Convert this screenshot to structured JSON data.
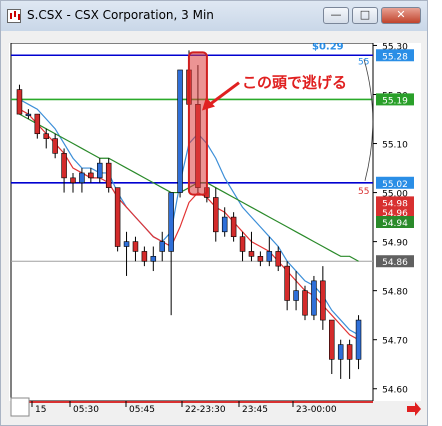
{
  "window": {
    "title": "S.CSX - CSX Corporation, 3 Min",
    "minimize_label": "—",
    "maximize_label": "□",
    "close_label": "✕",
    "app_icon": "chart-icon"
  },
  "chart_data": {
    "type": "candlestick",
    "ylim": [
      54.575,
      55.305
    ],
    "price_ticks": [
      "55.30",
      "55.20",
      "55.10",
      "55.00",
      "54.90",
      "54.80",
      "54.70",
      "54.60"
    ],
    "time_labels": [
      "15",
      "05:30",
      "05:45",
      "22-23:30",
      "23:45",
      "23-00:00"
    ],
    "candles": [
      {
        "o": 55.21,
        "h": 55.22,
        "l": 55.16,
        "c": 55.16
      },
      {
        "o": 55.16,
        "h": 55.17,
        "l": 55.15,
        "c": 55.16
      },
      {
        "o": 55.16,
        "h": 55.16,
        "l": 55.11,
        "c": 55.12
      },
      {
        "o": 55.12,
        "h": 55.13,
        "l": 55.09,
        "c": 55.11
      },
      {
        "o": 55.11,
        "h": 55.12,
        "l": 55.07,
        "c": 55.08
      },
      {
        "o": 55.08,
        "h": 55.09,
        "l": 55.0,
        "c": 55.03
      },
      {
        "o": 55.03,
        "h": 55.04,
        "l": 55.0,
        "c": 55.02
      },
      {
        "o": 55.02,
        "h": 55.05,
        "l": 55.0,
        "c": 55.04
      },
      {
        "o": 55.04,
        "h": 55.05,
        "l": 55.02,
        "c": 55.03
      },
      {
        "o": 55.03,
        "h": 55.07,
        "l": 55.02,
        "c": 55.06
      },
      {
        "o": 55.06,
        "h": 55.07,
        "l": 55.0,
        "c": 55.01
      },
      {
        "o": 55.01,
        "h": 55.01,
        "l": 54.88,
        "c": 54.89
      },
      {
        "o": 54.89,
        "h": 54.92,
        "l": 54.83,
        "c": 54.9
      },
      {
        "o": 54.9,
        "h": 54.91,
        "l": 54.86,
        "c": 54.88
      },
      {
        "o": 54.88,
        "h": 54.89,
        "l": 54.85,
        "c": 54.86
      },
      {
        "o": 54.86,
        "h": 54.89,
        "l": 54.84,
        "c": 54.87
      },
      {
        "o": 54.88,
        "h": 54.92,
        "l": 54.86,
        "c": 54.9
      },
      {
        "o": 54.88,
        "h": 54.99,
        "l": 54.75,
        "c": 55.0
      },
      {
        "o": 55.0,
        "h": 55.25,
        "l": 54.99,
        "c": 55.25
      },
      {
        "o": 55.25,
        "h": 55.29,
        "l": 55.17,
        "c": 55.18
      },
      {
        "o": 55.18,
        "h": 55.26,
        "l": 55.0,
        "c": 55.01
      },
      {
        "o": 55.01,
        "h": 55.03,
        "l": 54.98,
        "c": 54.99
      },
      {
        "o": 54.99,
        "h": 55.01,
        "l": 54.9,
        "c": 54.92
      },
      {
        "o": 54.92,
        "h": 54.97,
        "l": 54.91,
        "c": 54.95
      },
      {
        "o": 54.95,
        "h": 54.96,
        "l": 54.9,
        "c": 54.91
      },
      {
        "o": 54.91,
        "h": 54.92,
        "l": 54.86,
        "c": 54.88
      },
      {
        "o": 54.88,
        "h": 54.92,
        "l": 54.86,
        "c": 54.87
      },
      {
        "o": 54.87,
        "h": 54.88,
        "l": 54.85,
        "c": 54.86
      },
      {
        "o": 54.86,
        "h": 54.91,
        "l": 54.85,
        "c": 54.88
      },
      {
        "o": 54.88,
        "h": 54.89,
        "l": 54.84,
        "c": 54.85
      },
      {
        "o": 54.85,
        "h": 54.86,
        "l": 54.76,
        "c": 54.78
      },
      {
        "o": 54.78,
        "h": 54.84,
        "l": 54.76,
        "c": 54.8
      },
      {
        "o": 54.8,
        "h": 54.81,
        "l": 54.74,
        "c": 54.75
      },
      {
        "o": 54.75,
        "h": 54.83,
        "l": 54.74,
        "c": 54.82
      },
      {
        "o": 54.82,
        "h": 54.85,
        "l": 54.72,
        "c": 54.74
      },
      {
        "o": 54.74,
        "h": 54.74,
        "l": 54.63,
        "c": 54.66
      },
      {
        "o": 54.66,
        "h": 54.7,
        "l": 54.62,
        "c": 54.69
      },
      {
        "o": 54.69,
        "h": 54.7,
        "l": 54.62,
        "c": 54.66
      },
      {
        "o": 54.66,
        "h": 54.75,
        "l": 54.64,
        "c": 54.74
      }
    ],
    "moving_averages": [
      {
        "color": "#3d8fd8",
        "values": [
          55.19,
          55.18,
          55.17,
          55.15,
          55.13,
          55.1,
          55.07,
          55.05,
          55.05,
          55.04,
          55.04,
          55.0,
          54.97,
          54.95,
          54.93,
          54.91,
          54.9,
          54.92,
          55.02,
          55.1,
          55.12,
          55.1,
          55.07,
          55.03,
          55.0,
          54.97,
          54.95,
          54.93,
          54.91,
          54.89,
          54.86,
          54.84,
          54.82,
          54.81,
          54.79,
          54.76,
          54.74,
          54.72,
          54.71
        ]
      },
      {
        "color": "#e23434",
        "values": [
          55.17,
          55.16,
          55.14,
          55.12,
          55.1,
          55.08,
          55.05,
          55.04,
          55.03,
          55.03,
          55.02,
          54.99,
          54.97,
          54.95,
          54.93,
          54.91,
          54.9,
          54.89,
          54.93,
          54.98,
          55.0,
          54.99,
          54.97,
          54.96,
          54.94,
          54.92,
          54.9,
          54.89,
          54.88,
          54.86,
          54.84,
          54.82,
          54.8,
          54.79,
          54.77,
          54.75,
          54.73,
          54.71,
          54.7
        ]
      },
      {
        "color": "#2a8a2a",
        "values": [
          55.16,
          55.15,
          55.14,
          55.13,
          55.12,
          55.11,
          55.1,
          55.09,
          55.08,
          55.07,
          55.07,
          55.06,
          55.05,
          55.04,
          55.03,
          55.02,
          55.01,
          55.0,
          55.0,
          55.01,
          55.02,
          55.02,
          55.01,
          55.0,
          54.99,
          54.98,
          54.97,
          54.96,
          54.95,
          54.94,
          54.93,
          54.92,
          54.91,
          54.9,
          54.89,
          54.88,
          54.87,
          54.87,
          54.86
        ]
      }
    ],
    "horizontal_lines": [
      {
        "price": 55.28,
        "color": "#0000d0",
        "label": "55.28",
        "label_bg": "#2a8ee6"
      },
      {
        "price": 55.19,
        "color": "#2aaa2a",
        "label": "55.19",
        "label_bg": "#2aa02a"
      },
      {
        "price": 55.02,
        "color": "#0000d0",
        "label": "55.02",
        "label_bg": "#2a8ee6"
      },
      {
        "price": 54.86,
        "color": "#a0a0a0",
        "label": "54.86",
        "label_bg": "#606060"
      }
    ],
    "price_labels": [
      {
        "price": 54.98,
        "label": "54.98",
        "bg": "#d83030"
      },
      {
        "price": 54.96,
        "label": "54.96",
        "bg": "#d83030"
      },
      {
        "price": 54.94,
        "label": "54.94",
        "bg": "#2a8a2a"
      }
    ],
    "annotations": {
      "profit_text": "$0.29",
      "top_ma_label": "55",
      "low_ma_label": "55",
      "callout_text": "この頭で逃げる"
    }
  }
}
